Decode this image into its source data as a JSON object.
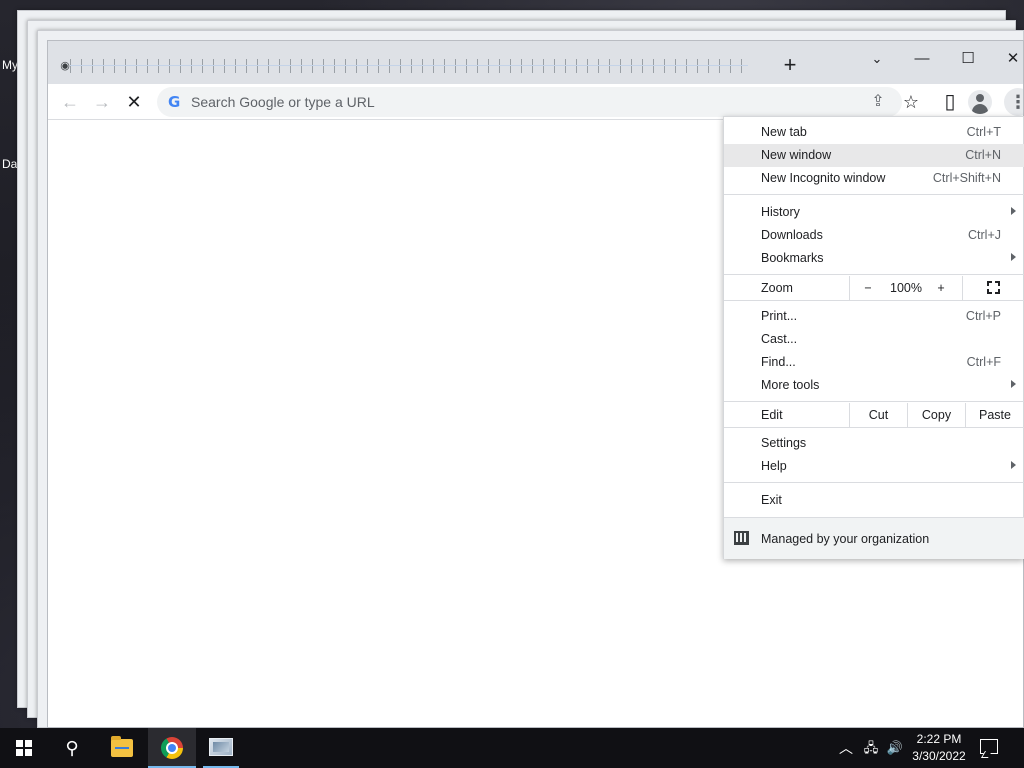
{
  "desktop": {
    "icon_label_1": "My",
    "icon_label_2": "Da"
  },
  "browser": {
    "tab_favicon": "chrome-favicon",
    "new_tab_symbol": "+",
    "window_controls": {
      "minimize": "—",
      "maximize": "☐",
      "close": "✕"
    },
    "nav": {
      "back": "←",
      "forward": "→",
      "stop": "✕"
    },
    "omnibox": {
      "google_letter": "G",
      "placeholder": "Search Google or type a URL"
    },
    "toolbar_icons": {
      "share": "⇪",
      "star": "☆",
      "side_panel": "▯",
      "menu": "⋮"
    }
  },
  "menu": {
    "items": [
      {
        "label": "New tab",
        "shortcut": "Ctrl+T"
      },
      {
        "label": "New window",
        "shortcut": "Ctrl+N"
      },
      {
        "label": "New Incognito window",
        "shortcut": "Ctrl+Shift+N"
      },
      {
        "label": "History",
        "shortcut": ""
      },
      {
        "label": "Downloads",
        "shortcut": "Ctrl+J"
      },
      {
        "label": "Bookmarks",
        "shortcut": ""
      },
      {
        "label": "Print...",
        "shortcut": "Ctrl+P"
      },
      {
        "label": "Cast...",
        "shortcut": ""
      },
      {
        "label": "Find...",
        "shortcut": "Ctrl+F"
      },
      {
        "label": "More tools",
        "shortcut": ""
      },
      {
        "label": "Settings",
        "shortcut": ""
      },
      {
        "label": "Help",
        "shortcut": ""
      },
      {
        "label": "Exit",
        "shortcut": ""
      }
    ],
    "zoom": {
      "label": "Zoom",
      "minus": "−",
      "value": "100%",
      "plus": "+"
    },
    "edit": {
      "label": "Edit",
      "cut": "Cut",
      "copy": "Copy",
      "paste": "Paste"
    },
    "managed": "Managed by your organization",
    "hovered_item": "New window"
  },
  "taskbar": {
    "search_glyph": "⚲",
    "tray": {
      "chevron": "︿",
      "network": "🖧",
      "volume": "🔊"
    },
    "time": "2:22 PM",
    "date": "3/30/2022"
  },
  "colors": {
    "tabstrip": "#dee1e6",
    "omnibox": "#f1f3f4",
    "menu_hover": "#e8e8e9",
    "taskbar": "#101014",
    "accent": "#76b9ed"
  }
}
